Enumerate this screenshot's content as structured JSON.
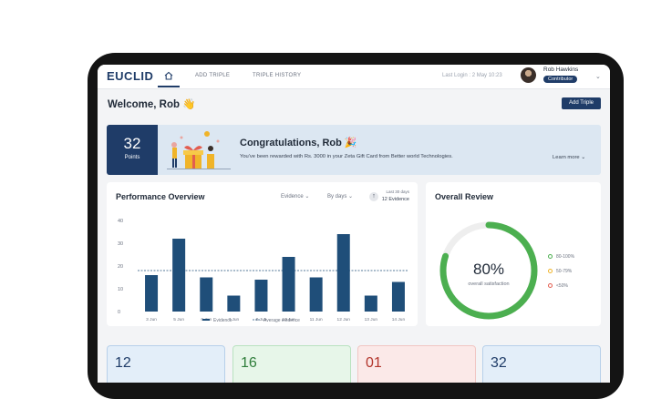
{
  "header": {
    "logo": "EUCLID",
    "nav": [
      "ADD TRIPLE",
      "TRIPLE HISTORY"
    ],
    "last_login": "Last Login : 2 May 10:23",
    "user_name": "Rob Hawkins",
    "user_role": "Contributor"
  },
  "welcome": "Welcome, Rob 👋",
  "add_button": "Add Triple",
  "banner": {
    "points": "32",
    "points_label": "Points",
    "title": "Congratulations, Rob 🎉",
    "message": "You've been rewarded with Rs. 3000 in your Zeta Gift Card from Better world Technologies.",
    "learn_more": "Learn more"
  },
  "performance": {
    "title": "Performance Overview",
    "filter_metric": "Evidence",
    "filter_period": "By days",
    "range_label": "Last 30 days",
    "range_value": "12 Evidence"
  },
  "review": {
    "title": "Overall Review",
    "percent": "80%",
    "caption": "overall satisfaction",
    "legend": [
      "80-100%",
      "50-79%",
      "<50%"
    ],
    "colors": {
      "high": "#4caf50",
      "mid": "#f0b429",
      "low": "#e35d4f"
    }
  },
  "stats": [
    {
      "value": "12",
      "bg": "#e3eef9",
      "border": "#b7d0ea",
      "color": "#1f3c68"
    },
    {
      "value": "16",
      "bg": "#e7f6e9",
      "border": "#b9e2c0",
      "color": "#2f7d3a"
    },
    {
      "value": "01",
      "bg": "#fbe9e8",
      "border": "#f1c6c3",
      "color": "#b3362c"
    },
    {
      "value": "32",
      "bg": "#e3eef9",
      "border": "#b7d0ea",
      "color": "#1f3c68"
    }
  ],
  "chart_data": {
    "type": "bar",
    "categories": [
      "3 Jun",
      "5 Jun",
      "6 Jun",
      "7 Jun",
      "8 Jun",
      "10 Jun",
      "11 Jun",
      "12 Jun",
      "13 Jun",
      "14 Jun"
    ],
    "series": [
      {
        "name": "Evidence",
        "values": [
          16,
          32,
          15,
          7,
          14,
          24,
          15,
          34,
          7,
          13
        ]
      }
    ],
    "average": 18,
    "average_label": "Average evidence",
    "yticks": [
      0,
      10,
      20,
      30,
      40
    ],
    "ylim": [
      0,
      40
    ],
    "bar_color": "#1f4e79",
    "grid": false,
    "legend_position": "bottom"
  }
}
